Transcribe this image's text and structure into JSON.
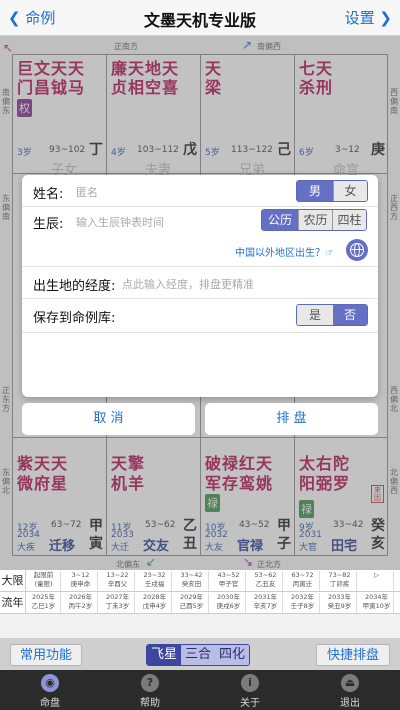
{
  "nav": {
    "back_label": "命例",
    "title": "文墨天机专业版",
    "settings_label": "设置"
  },
  "chart": {
    "directions": {
      "top_mid": "正南方",
      "top_right": "南偏西",
      "left_top": "南偏东",
      "left_mid": "东偏南",
      "left_lower": "正东方",
      "left_bottom": "东偏北",
      "right_top": "西偏南",
      "right_mid": "正西方",
      "right_lower": "西偏北",
      "right_bottom": "北偏西",
      "bottom_left": "北偏东",
      "bottom_right": "正北方"
    },
    "top_row": [
      {
        "line1": "巨文天天",
        "line2": "门昌钺马",
        "badge": "权",
        "age": "3岁",
        "range": "93~102",
        "gz": "丁"
      },
      {
        "line1": "廉天地天",
        "line2": "贞相空喜",
        "age": "4岁",
        "range": "103~112",
        "gz": "戊"
      },
      {
        "line1": "天",
        "line2": "梁",
        "age": "5岁",
        "range": "113~122",
        "gz": "己"
      },
      {
        "line1": "七天",
        "line2": "杀刑",
        "age": "6岁",
        "range": "3~12",
        "gz": "庚"
      }
    ],
    "top_peek": [
      "子女",
      "夫妻",
      "兄弟",
      "命宫"
    ],
    "bottom_row": [
      {
        "line1": "紫天天",
        "line2": "微府星",
        "age": "12岁",
        "year": "2034",
        "daxian": "大疾",
        "range": "63~72",
        "palace": "迁移",
        "gz1": "甲",
        "gz2": "寅"
      },
      {
        "line1": "天擎",
        "line2": "机羊",
        "age": "11岁",
        "year": "2033",
        "daxian": "大迁",
        "range": "53~62",
        "palace": "交友",
        "gz1": "乙",
        "gz2": "丑"
      },
      {
        "line1": "破禄红天",
        "line2": "军存鸾姚",
        "badge": "禄",
        "age": "10岁",
        "year": "2032",
        "daxian": "大友",
        "range": "43~52",
        "palace": "官禄",
        "gz1": "甲",
        "gz2": "子"
      },
      {
        "line1": "太右陀",
        "line2": "阳弼罗",
        "badge": "禄",
        "age": "9岁",
        "year": "2031",
        "daxian": "大官",
        "range": "33~42",
        "palace": "田宅",
        "gz1": "癸",
        "gz2": "亥",
        "stamp": "来因"
      }
    ]
  },
  "dialog": {
    "name_label": "姓名:",
    "name_placeholder": "匿名",
    "gender": [
      "男",
      "女"
    ],
    "birth_label": "生辰:",
    "birth_placeholder": "输入生辰钟表时间",
    "calendar": [
      "公历",
      "农历",
      "四柱"
    ],
    "overseas_link": "中国以外地区出生？☞",
    "longitude_label": "出生地的经度:",
    "longitude_placeholder": "点此输入经度，排盘更精准",
    "save_label": "保存到命例库:",
    "save_options": [
      "是",
      "否"
    ]
  },
  "buttons": {
    "cancel": "取 消",
    "paipan": "排 盘"
  },
  "daxian_row": {
    "label": "大限",
    "cells": [
      [
        "起限前",
        "(童限)"
      ],
      [
        "3~12",
        "庚申命"
      ],
      [
        "13~22",
        "辛酉父"
      ],
      [
        "23~32",
        "壬戌福"
      ],
      [
        "33~42",
        "癸亥田"
      ],
      [
        "43~52",
        "甲子官"
      ],
      [
        "53~62",
        "乙丑友"
      ],
      [
        "63~72",
        "丙寅迁"
      ],
      [
        "73~82",
        "丁卯疾"
      ],
      [
        "▷",
        ""
      ]
    ]
  },
  "liunian_row": {
    "label": "流年",
    "cells": [
      [
        "2025年",
        "乙巳1岁"
      ],
      [
        "2026年",
        "丙午2岁"
      ],
      [
        "2027年",
        "丁未3岁"
      ],
      [
        "2028年",
        "戊申4岁"
      ],
      [
        "2029年",
        "己酉5岁"
      ],
      [
        "2030年",
        "庚戌6岁"
      ],
      [
        "2031年",
        "辛亥7岁"
      ],
      [
        "2032年",
        "壬子8岁"
      ],
      [
        "2033年",
        "癸丑9岁"
      ],
      [
        "2034年",
        "甲寅10岁"
      ]
    ]
  },
  "toolbar": {
    "common": "常用功能",
    "modes": [
      "飞星",
      "三合",
      "四化"
    ],
    "quick": "快捷排盘"
  },
  "tabs": [
    {
      "label": "命盘",
      "icon": "◉"
    },
    {
      "label": "帮助",
      "icon": "?"
    },
    {
      "label": "关于",
      "icon": "i"
    },
    {
      "label": "退出",
      "icon": "⏏"
    }
  ]
}
